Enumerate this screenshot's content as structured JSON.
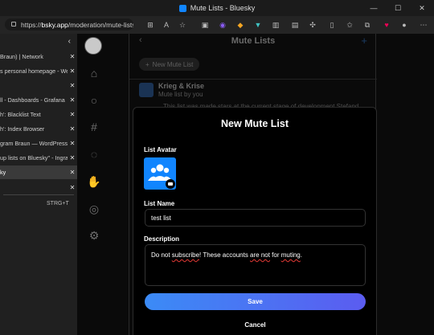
{
  "window": {
    "title": "Mute Lists - Bluesky",
    "controls": {
      "minimize": "—",
      "maximize": "☐",
      "close": "✕"
    }
  },
  "toolbar": {
    "url_scheme": "https://",
    "url_host": "bsky.app",
    "url_path": "/moderation/mute-lists"
  },
  "tabs": {
    "collapse": "‹",
    "items": [
      {
        "label": "Braun) | Network",
        "close": "✕",
        "active": false
      },
      {
        "label": "s personal homepage - Wer",
        "close": "✕",
        "active": false
      },
      {
        "label": "",
        "close": "✕",
        "active": false
      },
      {
        "label": "ll - Dashboards - Grafana",
        "close": "✕",
        "active": false
      },
      {
        "label": "h': Blacklist Text",
        "close": "✕",
        "active": false
      },
      {
        "label": "h': Index Browser",
        "close": "✕",
        "active": false
      },
      {
        "label": "gram Braun — WordPress",
        "close": "✕",
        "active": false
      },
      {
        "label": "up lists on Bluesky\" - Ingram",
        "close": "✕",
        "active": false
      },
      {
        "label": "ky",
        "close": "✕",
        "active": true
      },
      {
        "label": "",
        "close": "✕",
        "active": false
      }
    ],
    "shortcut": "STRG+T"
  },
  "app": {
    "page_title": "Mute Lists",
    "back": "‹",
    "add": "+",
    "new_list_button": "New Mute List",
    "new_list_plus": "+",
    "list": {
      "name": "Krieg & Krise",
      "byline": "Mute list by you",
      "description": "This list was made stars at the current stage of development Stefand"
    }
  },
  "modal": {
    "title": "New Mute List",
    "avatar_label": "List Avatar",
    "name_label": "List Name",
    "name_value": "test list",
    "description_label": "Description",
    "description_parts": [
      "Do not ",
      "subscribe",
      "! These accounts ",
      "are not",
      " for ",
      "muting",
      "."
    ],
    "save": "Save",
    "cancel": "Cancel"
  },
  "colors": {
    "accent": "#1185fe",
    "save_gradient_start": "#3b8bf6",
    "save_gradient_end": "#5b5cf0"
  }
}
